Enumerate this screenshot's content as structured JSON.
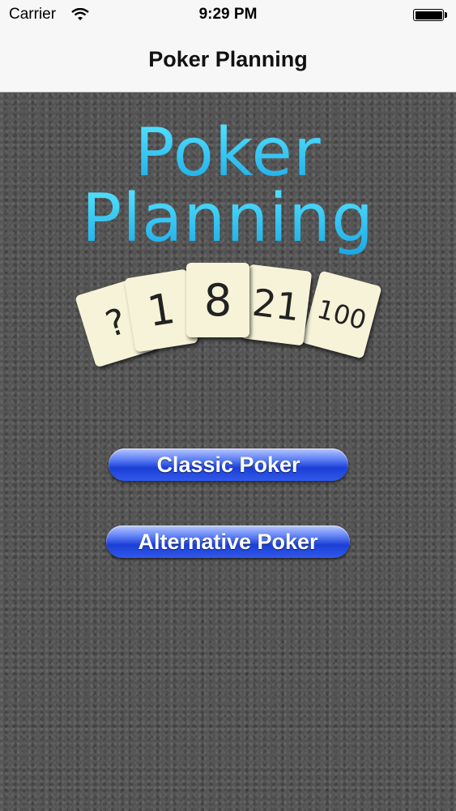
{
  "status_bar": {
    "carrier": "Carrier",
    "time": "9:29 PM",
    "icons": [
      "wifi-icon",
      "battery-icon"
    ],
    "battery_level": 1.0
  },
  "nav": {
    "title": "Poker Planning"
  },
  "logo": {
    "line1": "Poker",
    "line2": "Planning",
    "color": "#37c7ee"
  },
  "cards": [
    {
      "label": "?"
    },
    {
      "label": "1"
    },
    {
      "label": "8"
    },
    {
      "label": "21"
    },
    {
      "label": "100"
    }
  ],
  "buttons": {
    "classic": "Classic Poker",
    "alternative": "Alternative Poker",
    "color": "#2a4fe0"
  }
}
